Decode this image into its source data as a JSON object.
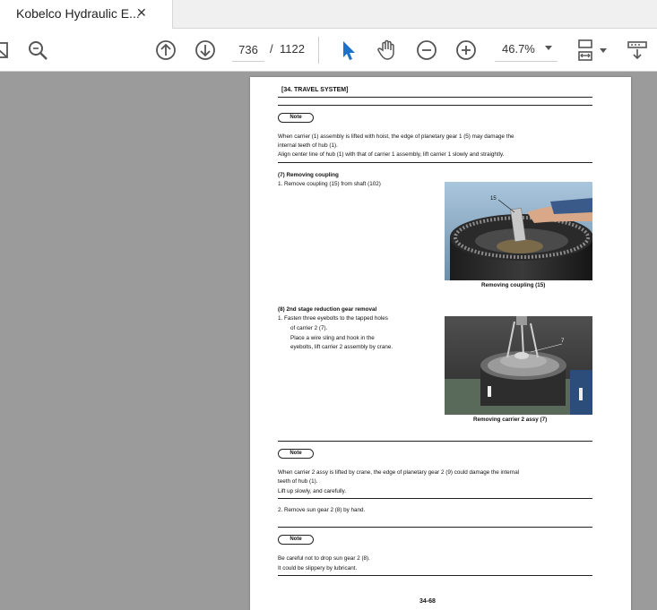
{
  "tab": {
    "title": "Kobelco Hydraulic E...",
    "close_glyph": "✕"
  },
  "toolbar": {
    "page_current": "736",
    "page_separator": "/",
    "page_total": "1122",
    "zoom": "46.7%",
    "icons": [
      "scroll-up-icon",
      "scroll-down-icon",
      "select-cursor-icon",
      "hand-pan-icon",
      "zoom-out-icon",
      "zoom-in-icon",
      "page-fit-icon",
      "scroll-mode-icon"
    ]
  },
  "document": {
    "header": "[34.   TRAVEL SYSTEM]",
    "note_label": "Note",
    "note1": [
      "When carrier  (1) assembly is lifted with hoist, the edge of planetary gear 1  (5) may damage the",
      "internal teeth of hub (1).",
      "Align center line of hub   (1) with that of carrier 1 assembly, lift carrier 1 slowly and straightly."
    ],
    "section7_title": "(7)  Removing  coupling",
    "section7_step": "1.    Remove coupling (15) from shaft (102)",
    "photo1_callout": "15",
    "photo1_caption": "Removing  coupling (15)",
    "section8_title": "(8)  2nd  stage  reduction  gear  removal",
    "section8_steps": [
      "1.    Fasten three eyebolts to the tapped holes",
      "of carrier 2  (7).",
      "Place a wire sling and hook in the",
      "eyebolts, lift carrier 2 assembly by crane."
    ],
    "photo2_callout": "7",
    "photo2_caption": "Removing  carrier 2  assy  (7)",
    "note2": [
      "When carrier 2 assy is lifted by crane, the edge of planetary gear 2  (9) could damage the internal",
      "teeth of hub (1).",
      "Lift up slowly, and carefully."
    ],
    "step2": "2.    Remove sun gear 2  (8)  by hand.",
    "note3": [
      "Be careful not to drop sun gear 2 (8).",
      "It could be slippery by lubricant."
    ],
    "page_number": "34-68"
  },
  "colors": {
    "accent": "#1a73c8",
    "background": "#9b9b9b",
    "toolbar": "#ffffff"
  }
}
